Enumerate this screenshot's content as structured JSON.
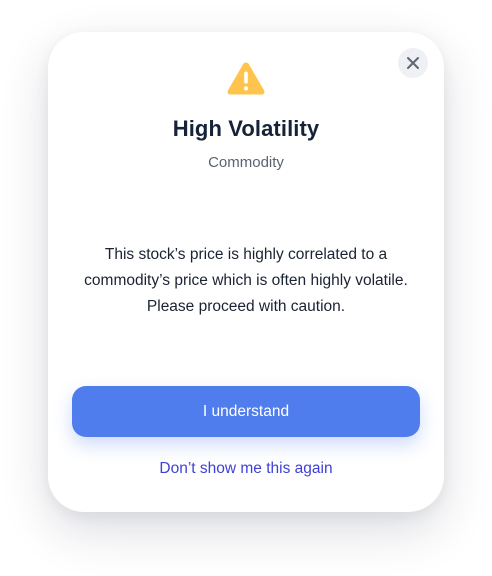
{
  "dialog": {
    "title": "High Volatility",
    "subtitle": "Commodity",
    "message_lines": [
      "This stock’s price is highly correlated to a",
      "commodity’s price which is often highly volatile.",
      "Please proceed with caution."
    ],
    "primary_button_label": "I understand",
    "secondary_link_label": "Don’t show me this again",
    "icons": {
      "warning": "warning-triangle-icon",
      "close": "close-icon"
    },
    "colors": {
      "warning": "#ffc44d",
      "primary": "#4f7ded",
      "link": "#3f40d8",
      "title": "#152238"
    }
  }
}
